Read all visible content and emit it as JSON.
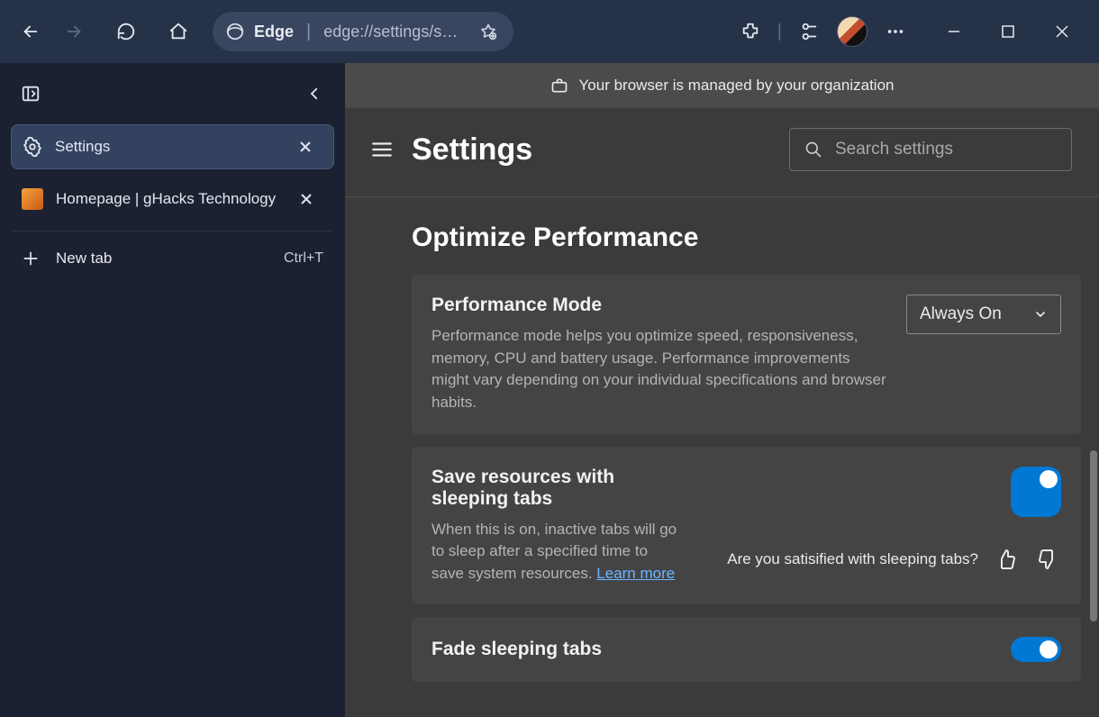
{
  "titlebar": {
    "app_label": "Edge",
    "url_display": "edge://settings/s…"
  },
  "vtabs": {
    "tabs": [
      {
        "label": "Settings"
      },
      {
        "label": "Homepage | gHacks Technology"
      }
    ],
    "newtab_label": "New tab",
    "newtab_shortcut": "Ctrl+T"
  },
  "managed_message": "Your browser is managed by your organization",
  "settings": {
    "title": "Settings",
    "search_placeholder": "Search settings",
    "section_title": "Optimize Performance",
    "perf_mode": {
      "title": "Performance Mode",
      "desc": "Performance mode helps you optimize speed, responsiveness, memory, CPU and battery usage. Performance improvements might vary depending on your individual specifications and browser habits.",
      "selected": "Always On"
    },
    "sleeping_tabs": {
      "title": "Save resources with sleeping tabs",
      "desc_prefix": "When this is on, inactive tabs will go to sleep after a specified time to save system resources. ",
      "learn_more": "Learn more",
      "feedback_q": "Are you satisified with sleeping tabs?"
    },
    "fade": {
      "title": "Fade sleeping tabs"
    }
  }
}
